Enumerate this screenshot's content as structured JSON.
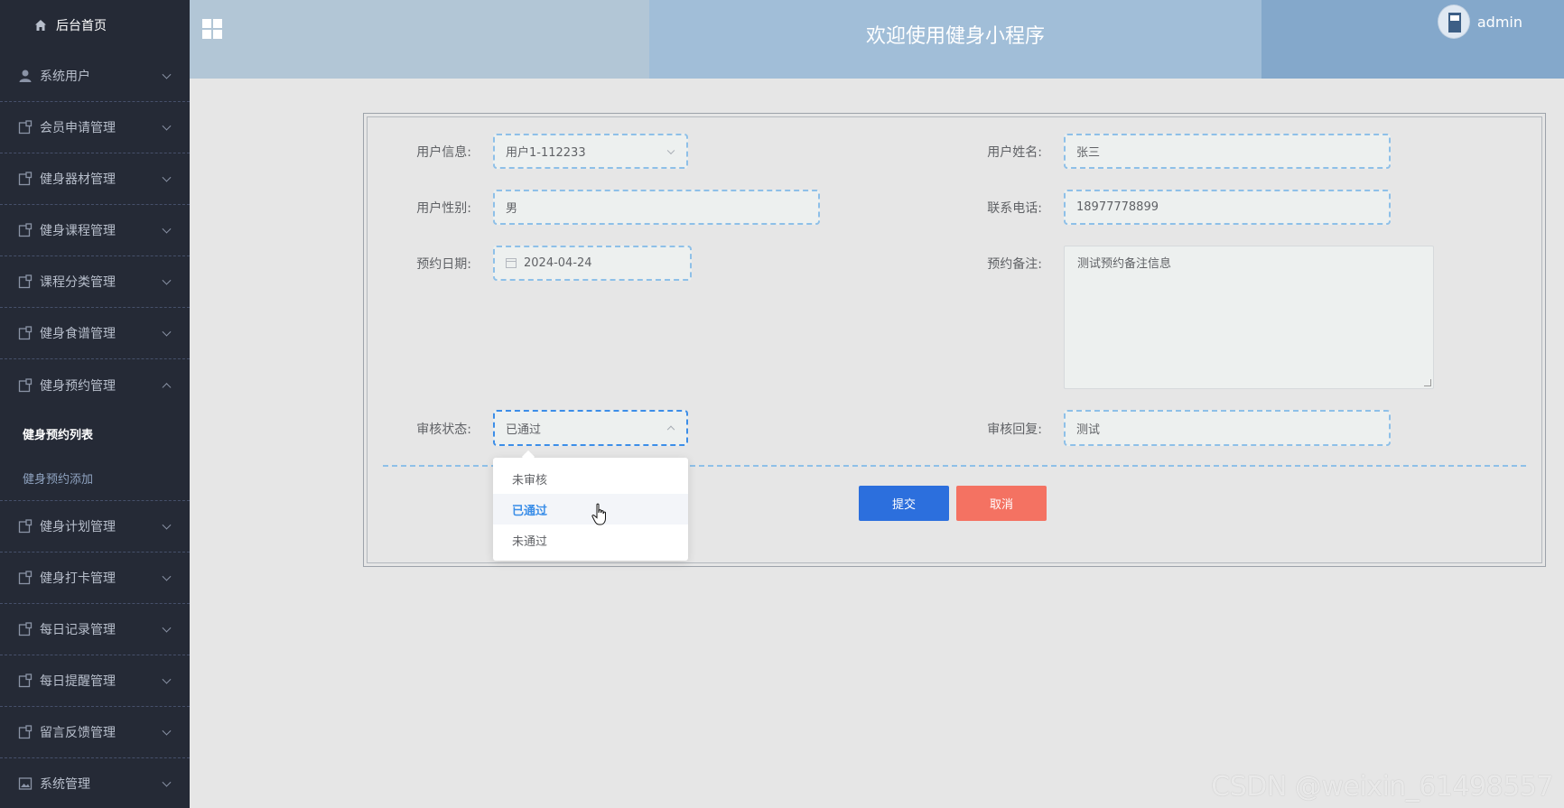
{
  "sidebar": {
    "home_label": "后台首页",
    "items": [
      {
        "label": "系统用户",
        "icon": "user-icon"
      },
      {
        "label": "会员申请管理",
        "icon": "doc-icon"
      },
      {
        "label": "健身器材管理",
        "icon": "doc-icon"
      },
      {
        "label": "健身课程管理",
        "icon": "doc-icon"
      },
      {
        "label": "课程分类管理",
        "icon": "doc-icon"
      },
      {
        "label": "健身食谱管理",
        "icon": "doc-icon"
      },
      {
        "label": "健身预约管理",
        "icon": "doc-icon",
        "expanded": true
      },
      {
        "label": "健身计划管理",
        "icon": "doc-icon"
      },
      {
        "label": "健身打卡管理",
        "icon": "doc-icon"
      },
      {
        "label": "每日记录管理",
        "icon": "doc-icon"
      },
      {
        "label": "每日提醒管理",
        "icon": "doc-icon"
      },
      {
        "label": "留言反馈管理",
        "icon": "doc-icon"
      },
      {
        "label": "系统管理",
        "icon": "image-icon"
      }
    ],
    "submenu": [
      {
        "label": "健身预约列表",
        "active": true
      },
      {
        "label": "健身预约添加",
        "active": false
      }
    ]
  },
  "header": {
    "title": "欢迎使用健身小程序",
    "username": "admin"
  },
  "form": {
    "user_info_label": "用户信息:",
    "user_info_value": "用户1-112233",
    "user_name_label": "用户姓名:",
    "user_name_value": "张三",
    "gender_label": "用户性别:",
    "gender_value": "男",
    "phone_label": "联系电话:",
    "phone_value": "18977778899",
    "date_label": "预约日期:",
    "date_value": "2024-04-24",
    "remark_label": "预约备注:",
    "remark_value": "测试预约备注信息",
    "status_label": "审核状态:",
    "status_value": "已通过",
    "reply_label": "审核回复:",
    "reply_value": "测试",
    "submit_label": "提交",
    "cancel_label": "取消"
  },
  "dropdown": {
    "options": [
      "未审核",
      "已通过",
      "未通过"
    ],
    "selected": "已通过"
  },
  "watermark": "CSDN @weixin_61498557",
  "colors": {
    "sidebar_bg": "#252a36",
    "submit": "#2c6fdd",
    "cancel": "#f47262",
    "accent": "#3b8ee8"
  }
}
